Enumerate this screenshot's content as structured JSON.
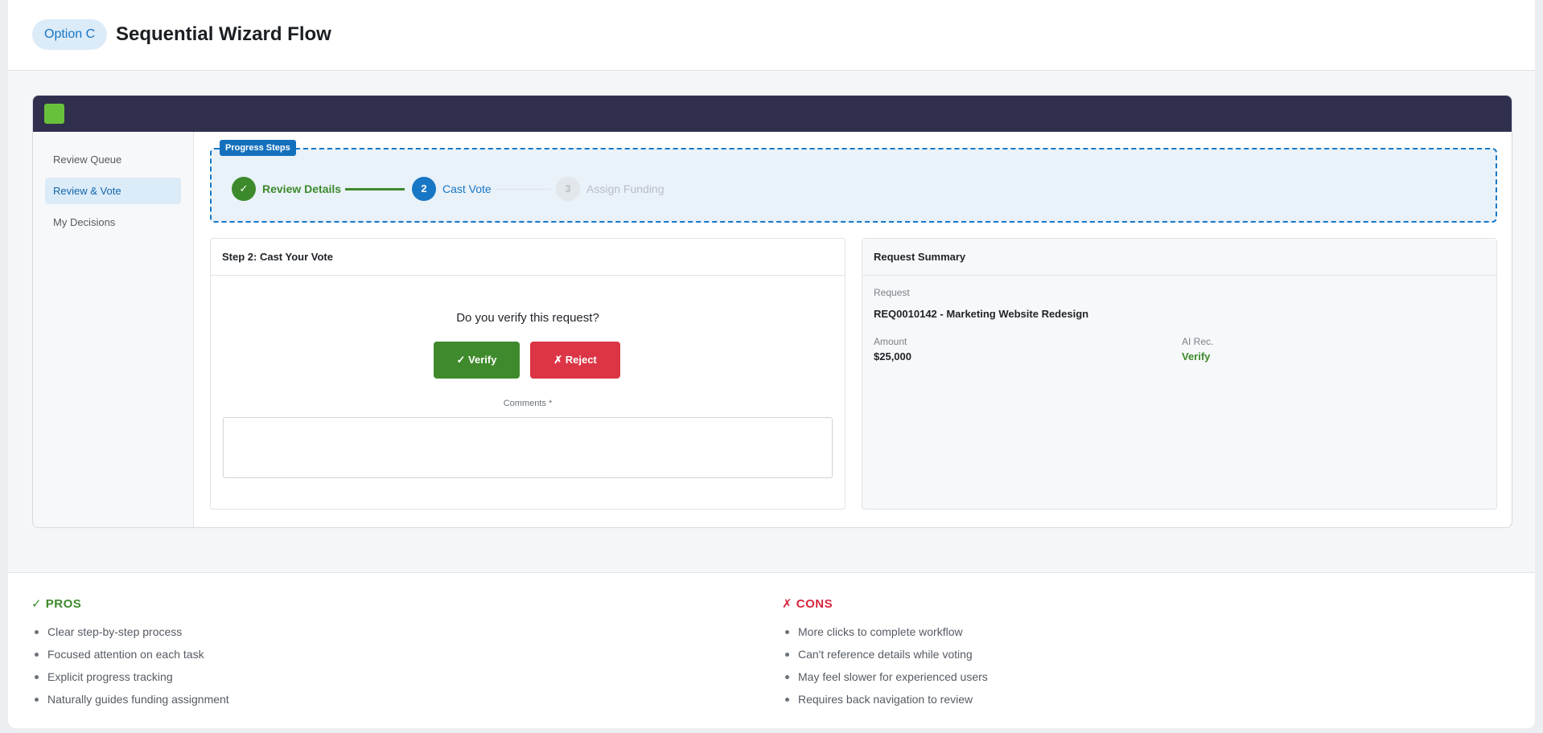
{
  "header": {
    "option_label": "Option C",
    "title": "Sequential Wizard Flow"
  },
  "colors": {
    "brand_navy": "#30304e",
    "accent_blue": "#1777c4",
    "success_green": "#3c8a2b",
    "danger_red": "#dc3545",
    "logo_green": "#68c13b"
  },
  "sidebar": {
    "items": [
      {
        "label": "Review Queue",
        "active": false
      },
      {
        "label": "Review & Vote",
        "active": true
      },
      {
        "label": "My Decisions",
        "active": false
      }
    ]
  },
  "progress": {
    "tag": "Progress Steps",
    "steps": [
      {
        "marker": "✓",
        "label": "Review Details",
        "state": "done"
      },
      {
        "marker": "2",
        "label": "Cast Vote",
        "state": "current"
      },
      {
        "marker": "3",
        "label": "Assign Funding",
        "state": "pending"
      }
    ]
  },
  "vote_card": {
    "title": "Step 2: Cast Your Vote",
    "question": "Do you verify this request?",
    "verify_label": "✓ Verify",
    "reject_label": "✗ Reject",
    "comments_label": "Comments *",
    "comments_value": ""
  },
  "summary_card": {
    "title": "Request Summary",
    "request_label": "Request",
    "request_value": "REQ0010142 - Marketing Website Redesign",
    "amount_label": "Amount",
    "amount_value": "$25,000",
    "ai_label": "AI Rec.",
    "ai_value": "Verify"
  },
  "pros": {
    "title": "✓ PROS",
    "items": [
      "Clear step-by-step process",
      "Focused attention on each task",
      "Explicit progress tracking",
      "Naturally guides funding assignment"
    ]
  },
  "cons": {
    "title": "✗ CONS",
    "items": [
      "More clicks to complete workflow",
      "Can't reference details while voting",
      "May feel slower for experienced users",
      "Requires back navigation to review"
    ]
  }
}
